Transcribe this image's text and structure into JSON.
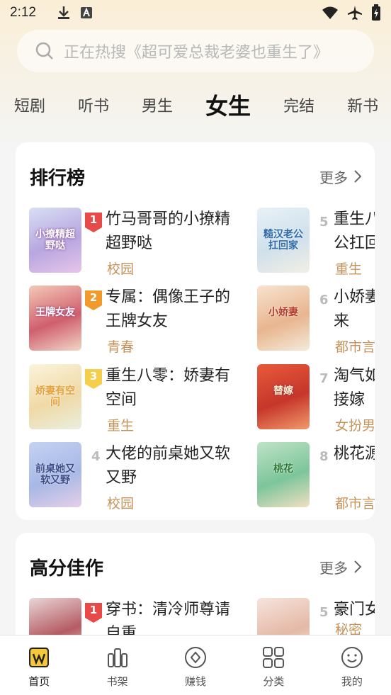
{
  "status": {
    "time": "2:12"
  },
  "search": {
    "placeholder": "正在热搜《超可爱总裁老婆也重生了》"
  },
  "tabs": [
    {
      "label": "短剧"
    },
    {
      "label": "听书"
    },
    {
      "label": "男生"
    },
    {
      "label": "女生",
      "active": true
    },
    {
      "label": "完结"
    },
    {
      "label": "新书"
    }
  ],
  "ranking": {
    "title": "排行榜",
    "more": "更多",
    "books": [
      {
        "rank": "1",
        "name": "竹马哥哥的小撩精超野哒",
        "tag": "校园",
        "cover_text": "小撩精超野哒"
      },
      {
        "rank": "2",
        "name": "专属：偶像王子的王牌女友",
        "tag": "青春",
        "cover_text": "王牌女友"
      },
      {
        "rank": "3",
        "name": "重生八零：娇妻有空间",
        "tag": "重生",
        "cover_text": "娇妻有空间"
      },
      {
        "rank": "4",
        "name": "大佬的前桌她又软又野",
        "tag": "校园",
        "cover_text": "前桌她又软又野"
      },
      {
        "rank": "5",
        "name": "重生八",
        "name_line2": "公扛回",
        "tag": "重生",
        "cover_text": "糙汉老公扛回家"
      },
      {
        "rank": "6",
        "name": "小娇妻",
        "name_line2": "来",
        "tag": "都市言",
        "cover_text": "小娇妻"
      },
      {
        "rank": "7",
        "name": "淘气如",
        "name_line2": "接嫁",
        "tag": "女扮男",
        "cover_text": "替嫁"
      },
      {
        "rank": "8",
        "name": "桃花源",
        "name_line2": "",
        "tag": "都市言",
        "cover_text": "桃花"
      }
    ]
  },
  "high_score": {
    "title": "高分佳作",
    "more": "更多",
    "books": [
      {
        "rank": "1",
        "name": "穿书：清冷师尊请自重",
        "tag": ""
      },
      {
        "rank": "5",
        "name": "豪门女",
        "tag": "秘密"
      }
    ]
  },
  "bottom_nav": [
    {
      "label": "首页",
      "icon": "home-icon",
      "active": true
    },
    {
      "label": "书架",
      "icon": "bookshelf-icon"
    },
    {
      "label": "赚钱",
      "icon": "coin-icon"
    },
    {
      "label": "分类",
      "icon": "category-icon"
    },
    {
      "label": "我的",
      "icon": "profile-icon"
    }
  ],
  "colors": {
    "accent": "#f7c54b",
    "badge_red": "#e84a4a",
    "badge_orange": "#f09a2c",
    "badge_yellow": "#f5cf4c",
    "tag": "#c6935a"
  }
}
